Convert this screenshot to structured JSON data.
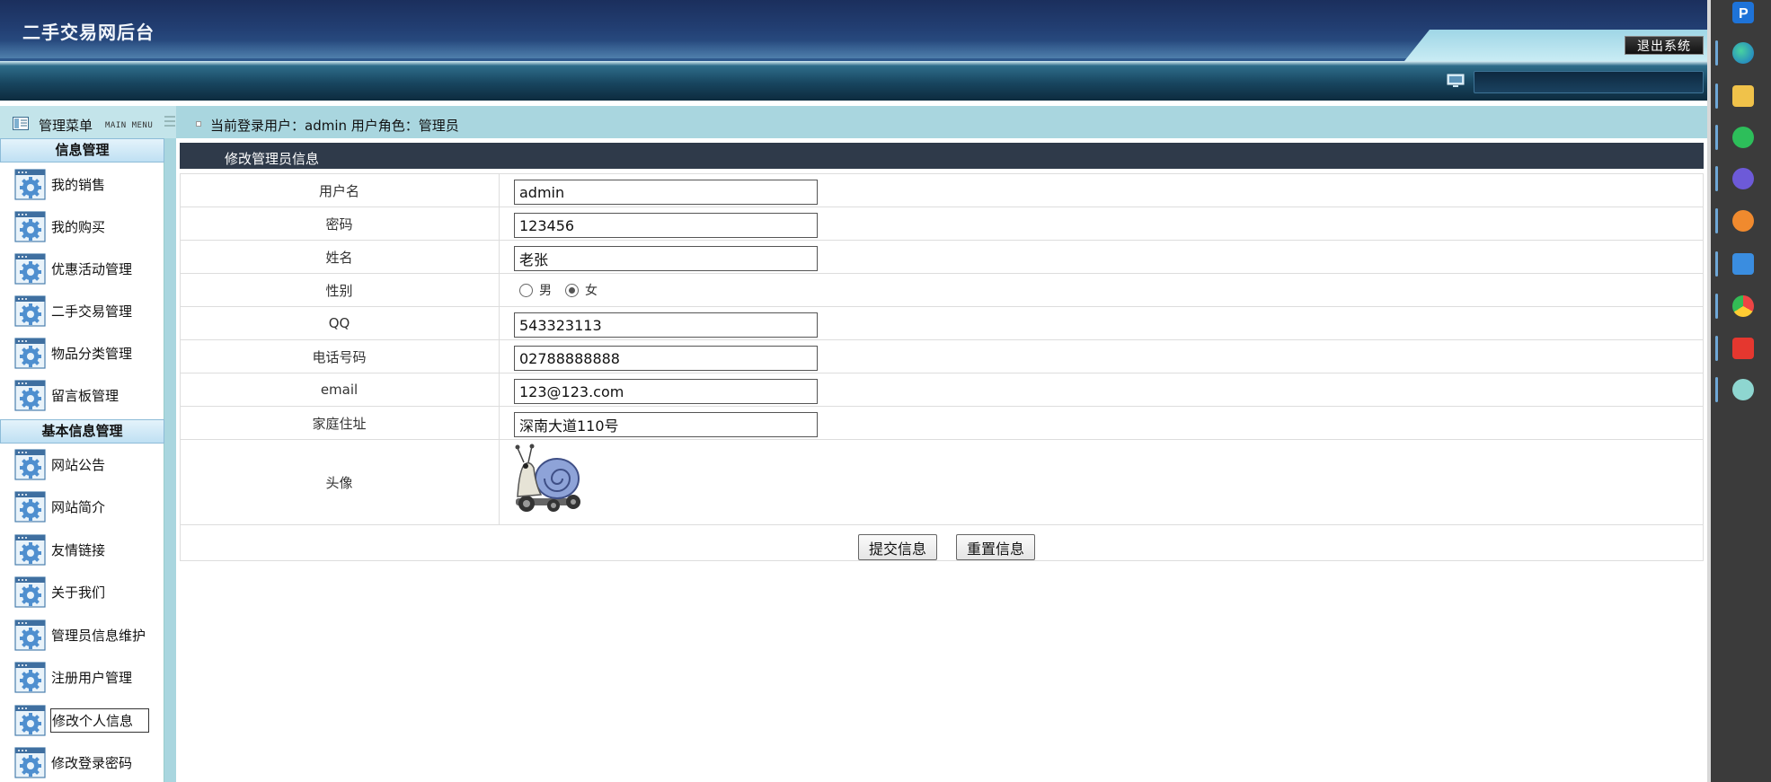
{
  "app": {
    "title": "二手交易网后台",
    "logout_label": "退出系统"
  },
  "sidebar": {
    "menu_title": "管理菜单",
    "menu_subtitle": "MAIN MENU",
    "sections": [
      {
        "title": "信息管理",
        "items": [
          "我的销售",
          "我的购买",
          "优惠活动管理",
          "二手交易管理",
          "物品分类管理",
          "留言板管理"
        ]
      },
      {
        "title": "基本信息管理",
        "items": [
          "网站公告",
          "网站简介",
          "友情链接",
          "关于我们",
          "管理员信息维护",
          "注册用户管理",
          "修改个人信息",
          "修改登录密码"
        ]
      }
    ],
    "active_item": "修改个人信息"
  },
  "header": {
    "user_info": "当前登录用户：admin  用户角色：管理员"
  },
  "form": {
    "title": "修改管理员信息",
    "fields": {
      "username": {
        "label": "用户名",
        "value": "admin"
      },
      "password": {
        "label": "密码",
        "value": "123456"
      },
      "name": {
        "label": "姓名",
        "value": "老张"
      },
      "gender": {
        "label": "性别",
        "options": [
          "男",
          "女"
        ],
        "selected": "女"
      },
      "qq": {
        "label": "QQ",
        "value": "543323113"
      },
      "phone": {
        "label": "电话号码",
        "value": "02788888888"
      },
      "email": {
        "label": "email",
        "value": "123@123.com"
      },
      "address": {
        "label": "家庭住址",
        "value": "深南大道110号"
      },
      "avatar": {
        "label": "头像"
      }
    },
    "submit_label": "提交信息",
    "reset_label": "重置信息"
  },
  "colors": {
    "accent": "#2f3a4a",
    "frame": "#a9d6df",
    "banner": "#223e72"
  }
}
